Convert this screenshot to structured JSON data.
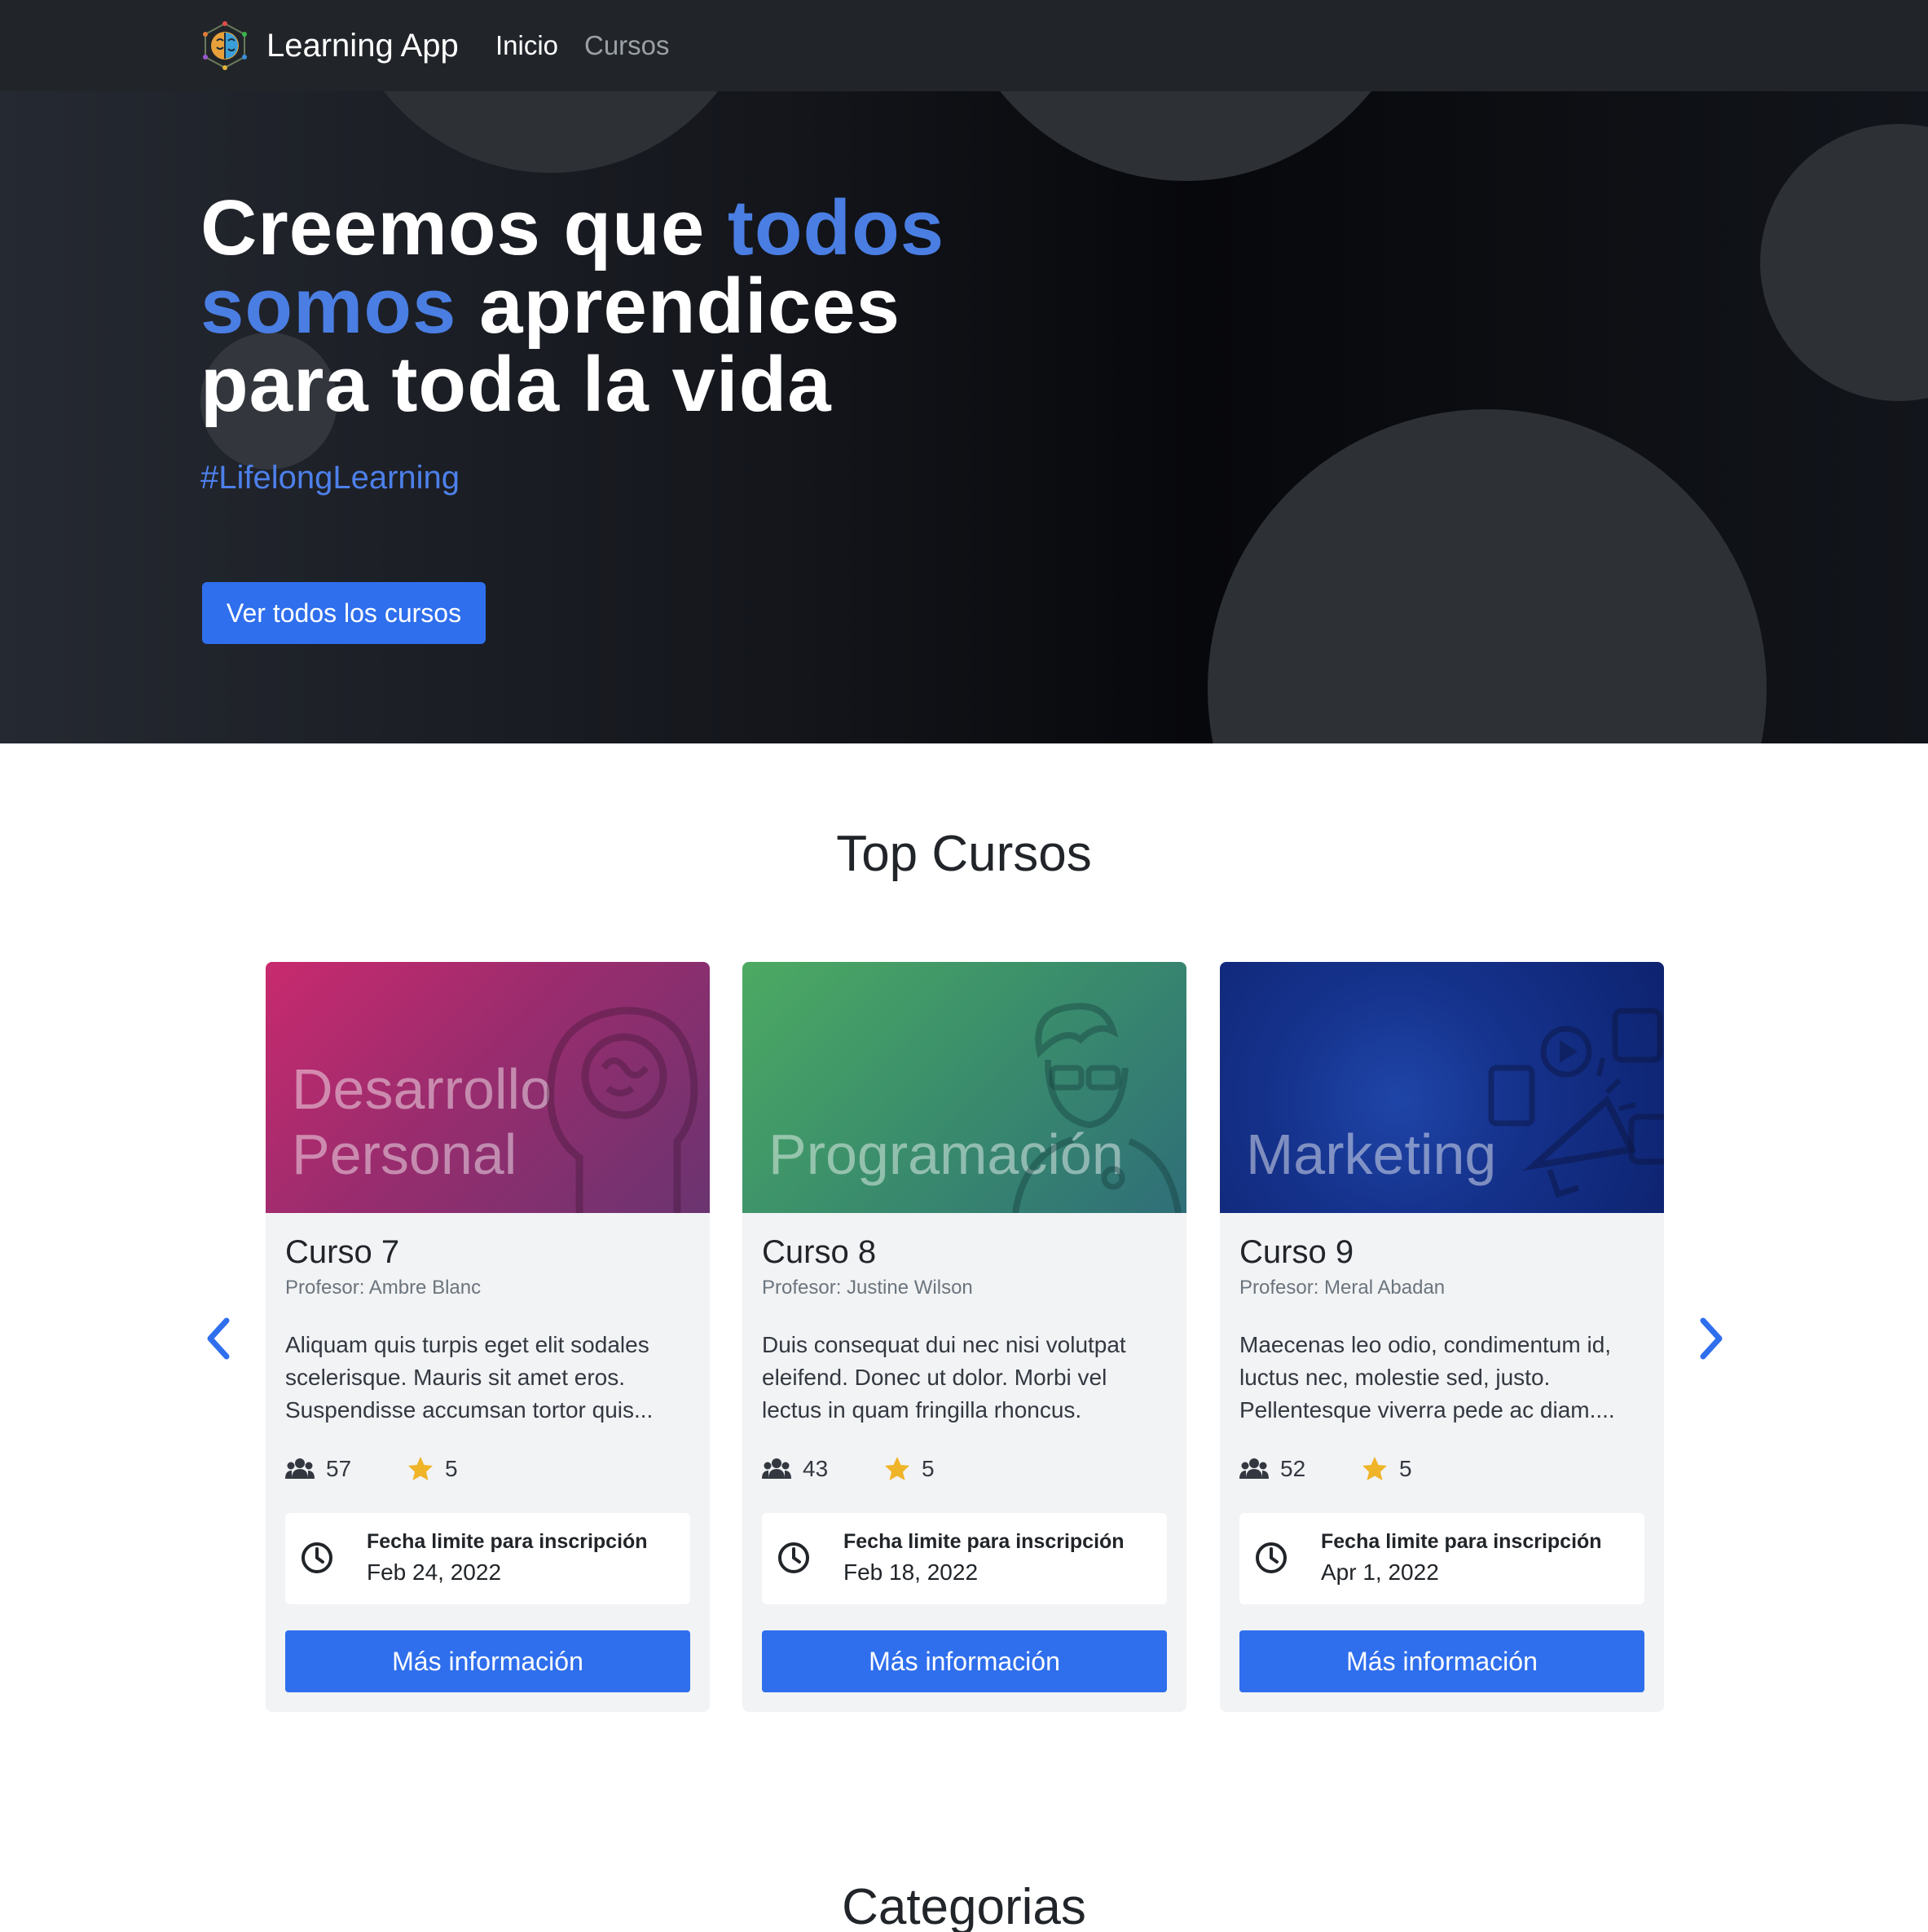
{
  "navbar": {
    "brand": "Learning App",
    "links": [
      {
        "label": "Inicio",
        "active": true
      },
      {
        "label": "Cursos",
        "active": false
      }
    ]
  },
  "hero": {
    "title_parts": [
      "Creemos que ",
      "todos somos",
      " aprendices para toda la vida"
    ],
    "title_line1_a": "Creemos que ",
    "title_line1_b": "todos",
    "title_line2_a": "somos",
    "title_line2_b": " aprendices",
    "title_line3": "para toda la vida",
    "hashtag": "#LifelongLearning",
    "cta_label": "Ver todos los cursos"
  },
  "top_courses": {
    "title": "Top Cursos",
    "prev_icon": "chevron-left-icon",
    "next_icon": "chevron-right-icon",
    "cards": [
      {
        "category_line1": "Desarrollo",
        "category_line2": "Personal",
        "art_icon": "head-brain-icon",
        "title": "Curso 7",
        "professor": "Profesor: Ambre Blanc",
        "description": "Aliquam quis turpis eget elit sodales scelerisque. Mauris sit amet eros. Suspendisse accumsan tortor quis...",
        "students": "57",
        "rating": "5",
        "deadline_label": "Fecha limite para inscripción",
        "deadline_date": "Feb 24, 2022",
        "button_label": "Más información"
      },
      {
        "category_line1": "",
        "category_line2": "Programación",
        "art_icon": "programmer-icon",
        "title": "Curso 8",
        "professor": "Profesor: Justine Wilson",
        "description": "Duis consequat dui nec nisi volutpat eleifend. Donec ut dolor. Morbi vel lectus in quam fringilla rhoncus.",
        "students": "43",
        "rating": "5",
        "deadline_label": "Fecha limite para inscripción",
        "deadline_date": "Feb 18, 2022",
        "button_label": "Más información"
      },
      {
        "category_line1": "",
        "category_line2": "Marketing",
        "art_icon": "megaphone-icon",
        "title": "Curso 9",
        "professor": "Profesor: Meral Abadan",
        "description": "Maecenas leo odio, condimentum id, luctus nec, molestie sed, justo. Pellentesque viverra pede ac diam....",
        "students": "52",
        "rating": "5",
        "deadline_label": "Fecha limite para inscripción",
        "deadline_date": "Apr 1, 2022",
        "button_label": "Más información"
      }
    ]
  },
  "categories": {
    "title": "Categorias"
  },
  "colors": {
    "primary": "#2f6fed",
    "accent_text": "#4a7ee3",
    "navbar_bg": "#212529",
    "star": "#f0b429",
    "card_personal_from": "#c92a6e",
    "card_personal_to": "#6a3470",
    "card_programacion_from": "#4caa62",
    "card_programacion_to": "#2f6e78",
    "card_marketing_from": "#0e2370",
    "card_marketing_to": "#1f45a8"
  }
}
